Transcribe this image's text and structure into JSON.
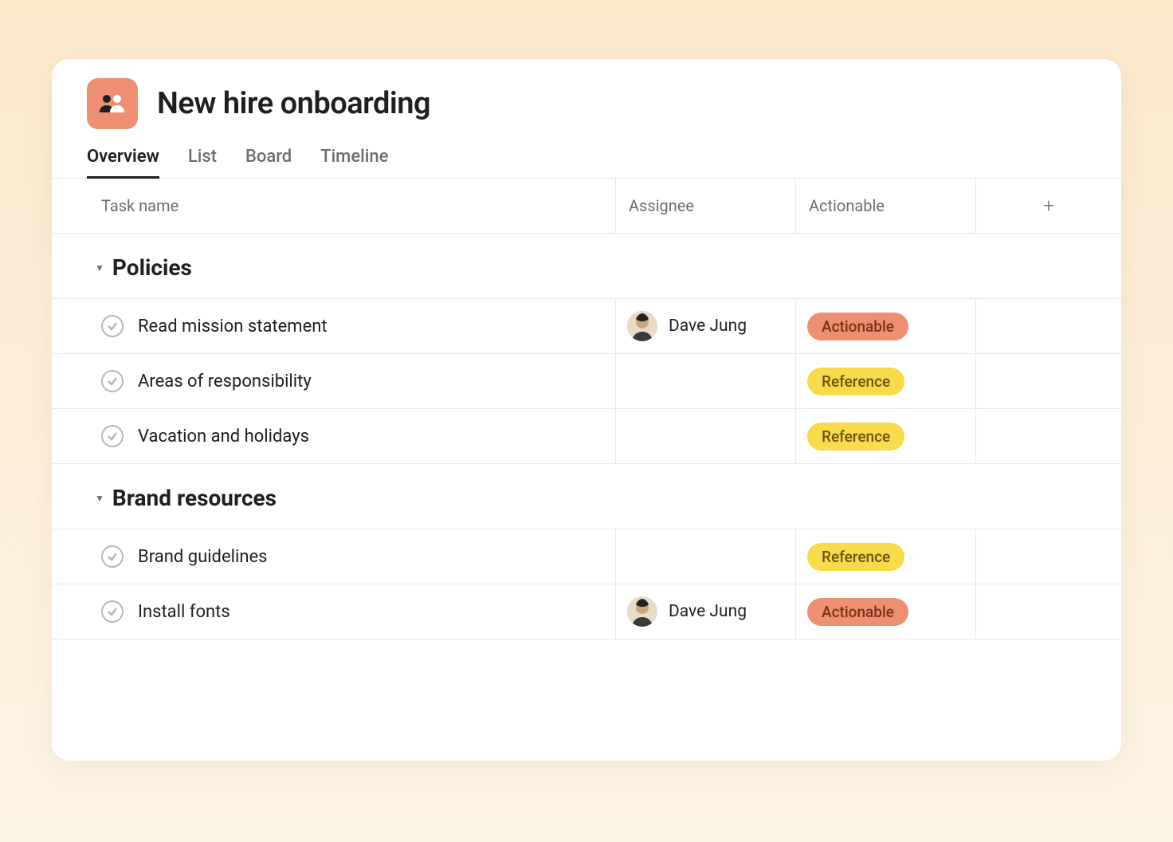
{
  "project": {
    "title": "New hire onboarding"
  },
  "tabs": [
    {
      "label": "Overview",
      "active": true
    },
    {
      "label": "List",
      "active": false
    },
    {
      "label": "Board",
      "active": false
    },
    {
      "label": "Timeline",
      "active": false
    }
  ],
  "columns": {
    "task_name": "Task name",
    "assignee": "Assignee",
    "actionable": "Actionable",
    "add": "+"
  },
  "tags": {
    "actionable": {
      "label": "Actionable",
      "class": "tag-actionable"
    },
    "reference": {
      "label": "Reference",
      "class": "tag-reference"
    }
  },
  "assignees": {
    "dave": "Dave Jung"
  },
  "sections": [
    {
      "title": "Policies",
      "tasks": [
        {
          "name": "Read mission statement",
          "assignee": "dave",
          "tag": "actionable"
        },
        {
          "name": "Areas of responsibility",
          "assignee": null,
          "tag": "reference"
        },
        {
          "name": "Vacation and holidays",
          "assignee": null,
          "tag": "reference"
        }
      ]
    },
    {
      "title": "Brand resources",
      "tasks": [
        {
          "name": "Brand guidelines",
          "assignee": null,
          "tag": "reference"
        },
        {
          "name": "Install fonts",
          "assignee": "dave",
          "tag": "actionable"
        }
      ]
    }
  ]
}
